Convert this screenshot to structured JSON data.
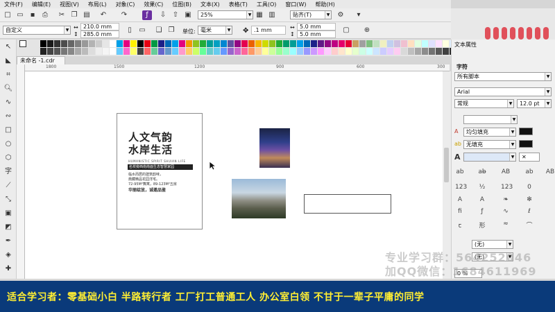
{
  "menu": [
    "文件(F)",
    "编辑(E)",
    "视图(V)",
    "布局(L)",
    "对象(C)",
    "效果(C)",
    "位图(B)",
    "文本(X)",
    "表格(T)",
    "工具(O)",
    "窗口(W)",
    "帮助(H)"
  ],
  "toolbar1": {
    "zoom": "25%",
    "snap": "贴齐(T)"
  },
  "toolbar2": {
    "preset": "自定义",
    "width": "210.0 mm",
    "height": "285.0 mm",
    "units_label": "单位:",
    "units": "毫米",
    "nudge": ".1 mm",
    "dup_x": "5.0 mm",
    "dup_y": "5.0 mm"
  },
  "doc_tab": "未命名 -1.cdr",
  "ruler_labels": [
    "1800",
    "1500",
    "1200",
    "900",
    "600",
    "300"
  ],
  "page_content": {
    "headline_1": "人文气韵",
    "headline_2": "水岸生活",
    "english": "HUMANISTIC SPIRIT SHUIAN LIFE",
    "bar_text": "名校旁西南南面生态智慧家园",
    "line_1": "临水而居的建筑韵味，",
    "line_2": "典藏精品花园洋宅。",
    "line_3": "72-95M²舞寓，89-123M²五房",
    "line_4": "华丽绽放，诚邀品鉴"
  },
  "right_panel": {
    "title": "文本属性",
    "section": "字符",
    "script": "所有脚本",
    "font": "Arial",
    "style": "常规",
    "size": "12.0 pt",
    "fill_1": "均匀填充",
    "fill_2": "无填充",
    "none_1": "(无)",
    "none_2": "(无)",
    "x_value": "0 %"
  },
  "watermark": {
    "line_1": "专业学习群：564252046",
    "line_2": "加QQ微信：1684611969"
  },
  "banner": "适合学习者：零基础小白 半路转行者 工厂打工普通工人 办公室白领 不甘于一辈子平庸的同学",
  "colors": {
    "banner_bg": "#0a3a7a",
    "banner_text": "#ffee33"
  }
}
